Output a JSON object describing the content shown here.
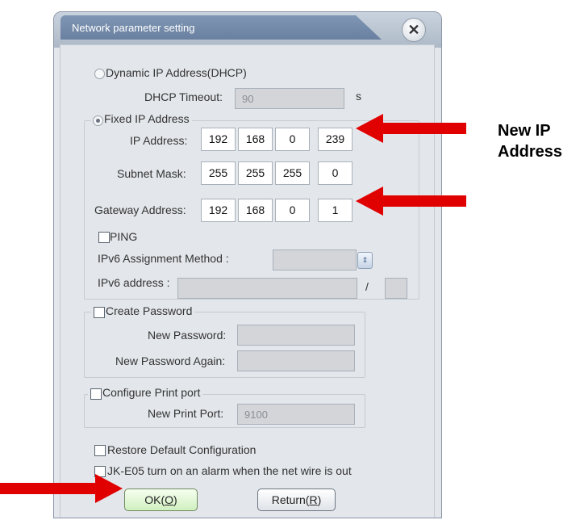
{
  "dialog": {
    "title": "Network parameter setting",
    "close_glyph": "✕"
  },
  "dhcp": {
    "label": "Dynamic IP Address(DHCP)",
    "selected": false
  },
  "dhcp_timeout": {
    "label": "DHCP Timeout:",
    "value": "90",
    "unit": "s"
  },
  "fixed_ip": {
    "label": "Fixed IP Address",
    "selected": true
  },
  "ip_address": {
    "label": "IP Address:",
    "octets": [
      "192",
      "168",
      "0",
      "239"
    ]
  },
  "subnet_mask": {
    "label": "Subnet Mask:",
    "octets": [
      "255",
      "255",
      "255",
      "0"
    ]
  },
  "gateway": {
    "label": "Gateway Address:",
    "octets": [
      "192",
      "168",
      "0",
      "1"
    ]
  },
  "ping": {
    "label": "PING",
    "checked": false
  },
  "ipv6_method": {
    "label": "IPv6 Assignment Method :",
    "value": "",
    "spin_icon": "spinner-icon"
  },
  "ipv6_address": {
    "label": "IPv6 address :",
    "value": "",
    "separator": "/",
    "prefix": ""
  },
  "password": {
    "label": "Create Password",
    "checked": false,
    "new_label": "New Password:",
    "again_label": "New Password Again:",
    "new_value": "",
    "again_value": ""
  },
  "print_port": {
    "label": "Configure Print port",
    "checked": false,
    "new_label": "New Print Port:",
    "value": "9100"
  },
  "restore": {
    "label": "Restore Default Configuration",
    "checked": false
  },
  "alarm": {
    "label": "JK-E05 turn on an alarm when the net wire is out",
    "checked": false
  },
  "buttons": {
    "ok": "OK(O)",
    "ok_prefix": "OK(",
    "ok_key": "O",
    "ok_suffix": ")",
    "return_prefix": "Return(",
    "return_key": "R",
    "return_suffix": ")"
  },
  "annotation": {
    "line1": "New IP",
    "line2": "Address"
  },
  "colors": {
    "arrow": "#e00000",
    "ok_button": "#d0efc0",
    "title_tab": "#6a80a0"
  }
}
